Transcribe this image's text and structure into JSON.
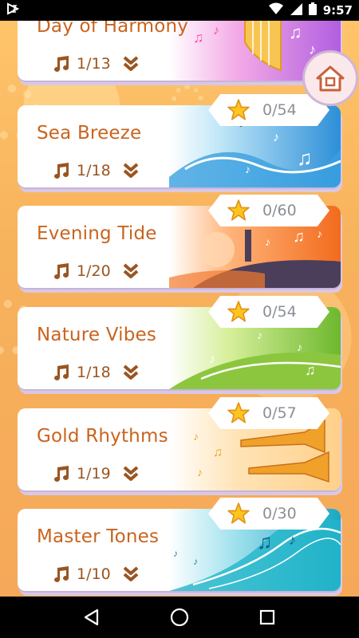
{
  "status_bar": {
    "time": "9:57",
    "icons": [
      "play-store-notification-icon",
      "wifi-icon",
      "signal-icon",
      "battery-icon"
    ]
  },
  "home_button": {
    "icon": "house-icon"
  },
  "colors": {
    "title": "#c9641e",
    "meta": "#9a5520",
    "stars_count": "#8a8f96"
  },
  "cards": [
    {
      "title": "Day of Harmony",
      "songs": "1/13",
      "stars": null,
      "art": "harp-purple"
    },
    {
      "title": "Sea Breeze",
      "songs": "1/18",
      "stars": "0/54",
      "art": "wave-blue"
    },
    {
      "title": "Evening Tide",
      "songs": "1/20",
      "stars": "0/60",
      "art": "sunset-orange"
    },
    {
      "title": "Nature Vibes",
      "songs": "1/18",
      "stars": "0/54",
      "art": "hill-green"
    },
    {
      "title": "Gold Rhythms",
      "songs": "1/19",
      "stars": "0/57",
      "art": "trumpet-gold"
    },
    {
      "title": "Master Tones",
      "songs": "1/10",
      "stars": "0/30",
      "art": "wave-teal"
    }
  ],
  "nav_bar": {
    "items": [
      "back-icon",
      "home-circle-icon",
      "recents-icon"
    ]
  }
}
